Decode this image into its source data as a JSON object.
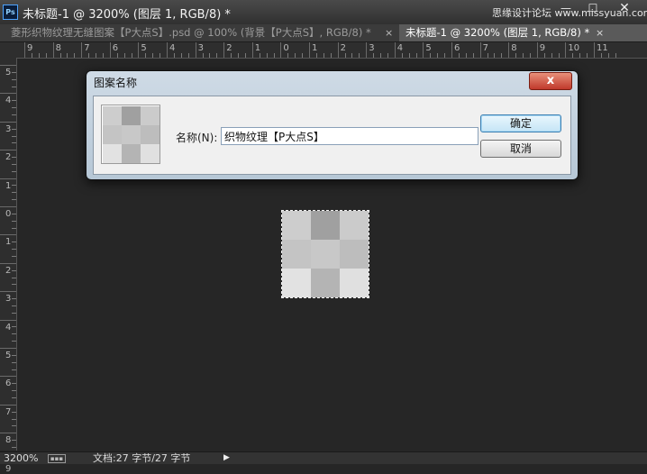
{
  "window": {
    "title": "未标题-1 @ 3200% (图层 1, RGB/8) *",
    "app_icon": "Ps",
    "watermark": "思缘设计论坛 www.missyuan.com",
    "min_glyph": "—",
    "max_glyph": "☐",
    "close_glyph": "✕"
  },
  "tabs": [
    {
      "label": "菱形织物纹理无缝图案【P大点S】.psd @ 100% (背景【P大点S】, RGB/8) *",
      "close": "×",
      "active": false
    },
    {
      "label": "未标题-1 @ 3200% (图层 1, RGB/8) *",
      "close": "×",
      "active": true
    }
  ],
  "rulers": {
    "horizontal_labels": [
      "9",
      "8",
      "7",
      "6",
      "5",
      "4",
      "3",
      "2",
      "1",
      "0",
      "1",
      "2",
      "3",
      "4",
      "5",
      "6",
      "7",
      "8",
      "9",
      "10",
      "11"
    ],
    "vertical_labels": [
      "5",
      "4",
      "3",
      "2",
      "1",
      "0",
      "1",
      "2",
      "3",
      "4",
      "5",
      "6",
      "7",
      "8",
      "9"
    ]
  },
  "canvas": {
    "pattern": {
      "rows": 3,
      "cols": 3,
      "cells": [
        "#cdcdcd",
        "#a0a0a0",
        "#cbcbcb",
        "#c4c4c4",
        "#c8c8c8",
        "#bdbdbd",
        "#e2e2e2",
        "#b4b4b4",
        "#e0e0e0"
      ]
    }
  },
  "dialog": {
    "title": "图案名称",
    "close_glyph": "x",
    "name_label": "名称(N):",
    "name_value": "织物纹理【P大点S】",
    "ok_label": "确定",
    "cancel_label": "取消"
  },
  "status": {
    "zoom": "3200%",
    "doc_size": "文档:27 字节/27 字节",
    "arrow": "▶"
  }
}
